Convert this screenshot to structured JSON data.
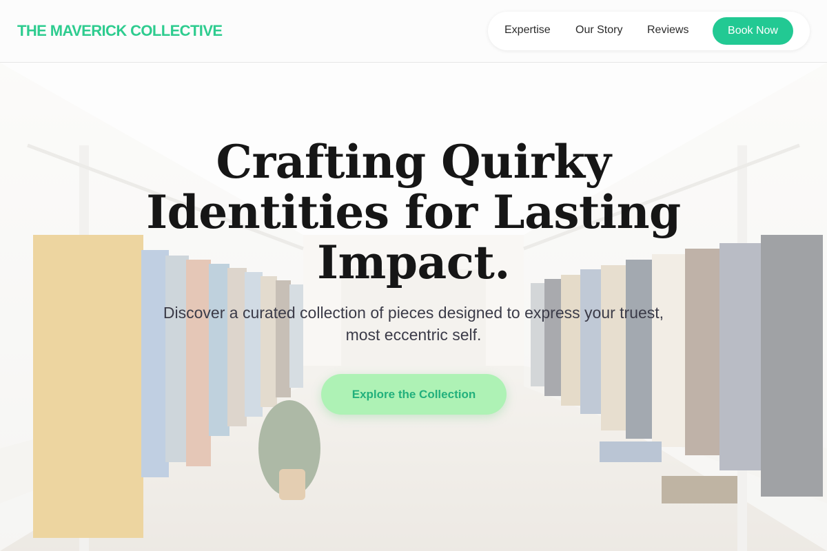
{
  "brand": {
    "logo_text": "THE MAVERICK COLLECTIVE"
  },
  "nav": {
    "links": [
      "Expertise",
      "Our Story",
      "Reviews"
    ],
    "cta_label": "Book Now"
  },
  "hero": {
    "headline_lines": [
      "Crafting Quirky",
      "Identities for Lasting",
      "Impact."
    ],
    "subtext_lines": [
      "Discover a curated collection of pieces designed to express your truest,",
      "most eccentric self."
    ],
    "cta_label": "Explore the Collection",
    "background_image": "clothing-boutique-photo"
  },
  "colors": {
    "brand_green": "#2ecc8f",
    "book_button": "#22c993",
    "cta_bg": "#aef2b5",
    "cta_text": "#22b07c",
    "headline": "#161616"
  }
}
